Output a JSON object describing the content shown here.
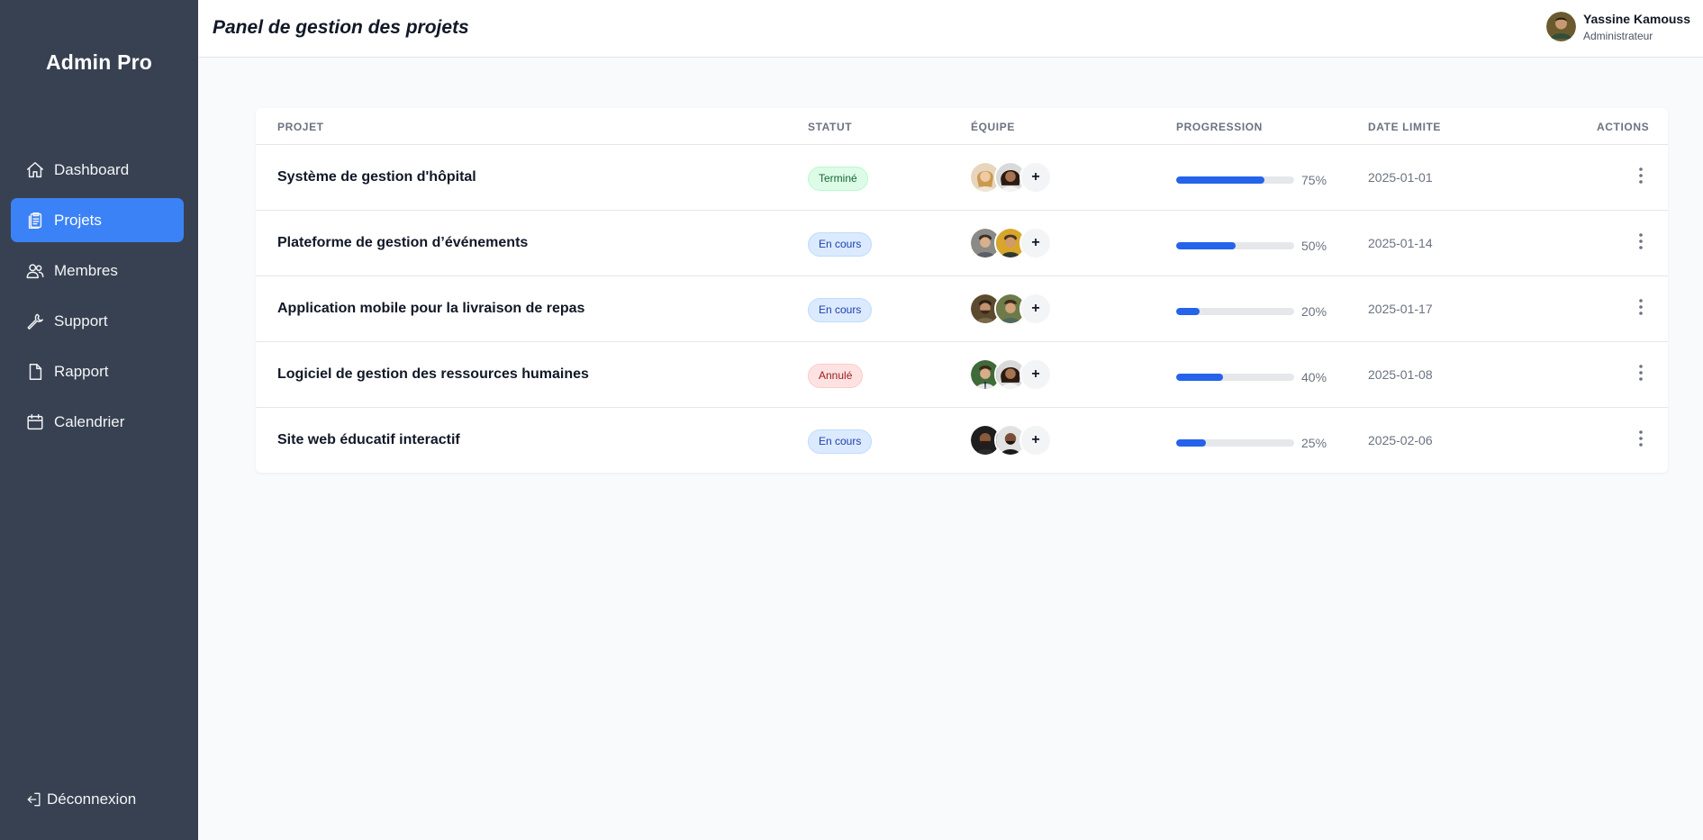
{
  "sidebar": {
    "brand": "Admin Pro",
    "items": [
      {
        "label": "Dashboard",
        "icon": "home-icon",
        "active": false
      },
      {
        "label": "Projets",
        "icon": "clipboard-icon",
        "active": true
      },
      {
        "label": "Membres",
        "icon": "users-icon",
        "active": false
      },
      {
        "label": "Support",
        "icon": "wrench-icon",
        "active": false
      },
      {
        "label": "Rapport",
        "icon": "document-icon",
        "active": false
      },
      {
        "label": "Calendrier",
        "icon": "calendar-icon",
        "active": false
      }
    ],
    "logout_label": "Déconnexion"
  },
  "header": {
    "title": "Panel de gestion des projets",
    "user_name": "Yassine Kamouss",
    "user_role": "Administrateur"
  },
  "table": {
    "columns": [
      "Projet",
      "Statut",
      "Équipe",
      "Progression",
      "Date limite",
      "Actions"
    ],
    "rows": [
      {
        "name": "Système de gestion d'hôpital",
        "status": "Terminé",
        "status_type": "done",
        "progress": 75,
        "progress_label": "75%",
        "deadline": "2025-01-01",
        "add_label": "+"
      },
      {
        "name": "Plateforme de gestion d’événements",
        "status": "En cours",
        "status_type": "progress",
        "progress": 50,
        "progress_label": "50%",
        "deadline": "2025-01-14",
        "add_label": "+"
      },
      {
        "name": "Application mobile pour la livraison de repas",
        "status": "En cours",
        "status_type": "progress",
        "progress": 20,
        "progress_label": "20%",
        "deadline": "2025-01-17",
        "add_label": "+"
      },
      {
        "name": "Logiciel de gestion des ressources humaines",
        "status": "Annulé",
        "status_type": "cancel",
        "progress": 40,
        "progress_label": "40%",
        "deadline": "2025-01-08",
        "add_label": "+"
      },
      {
        "name": "Site web éducatif interactif",
        "status": "En cours",
        "status_type": "progress",
        "progress": 25,
        "progress_label": "25%",
        "deadline": "2025-02-06",
        "add_label": "+"
      }
    ]
  },
  "colors": {
    "sidebar_bg": "#374151",
    "accent": "#3b82f6",
    "progress_fill": "#2563eb"
  }
}
